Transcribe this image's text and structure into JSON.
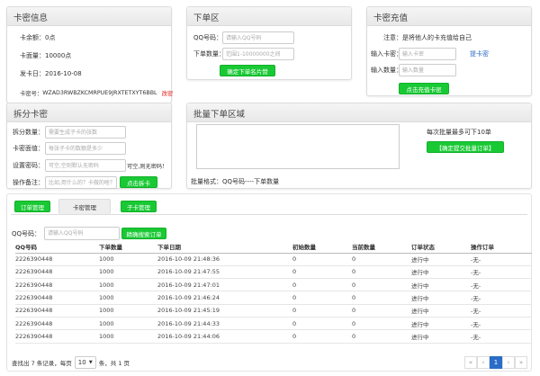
{
  "card_info": {
    "title": "卡密信息",
    "balance_label": "卡余额：",
    "balance_value": "0点",
    "quantity_label": "卡面量：",
    "quantity_value": "10000点",
    "issue_date_label": "发卡日：",
    "issue_date_value": "2016-10-08",
    "card_no_label": "卡密号：",
    "card_no_value": "WZAD3RWBZKCMRPUE9JRXTETXYT6BBL",
    "change_link": "改密"
  },
  "order_area": {
    "title": "下单区",
    "qq_label": "QQ号码：",
    "qq_placeholder": "请输入QQ号码",
    "qty_label": "下单数量：",
    "qty_placeholder": "范围1-10000000之间",
    "submit": "确定下单名片赞"
  },
  "recharge": {
    "title": "卡密充值",
    "notice_label": "注意：",
    "notice_text": "是将他人的卡充值给自己",
    "card_label": "输入卡密：",
    "card_placeholder": "输入卡密",
    "buy_link": "提卡密",
    "qty_label": "输入数量：",
    "qty_placeholder": "输入数量",
    "submit": "点击充值卡密"
  },
  "split": {
    "title": "拆分卡密",
    "count_label": "拆分数量：",
    "count_placeholder": "需要生成子卡的张数",
    "face_label": "卡密面值：",
    "face_placeholder": "每张子卡的数额是多少",
    "pwd_label": "设置密码：",
    "pwd_placeholder": "可空,空则默认无密码",
    "pwd_note": "可空,则无密码！",
    "remark_label": "操作备注：",
    "remark_placeholder": "比如,用什么的？卡做的啥？",
    "submit": "点击拆卡"
  },
  "batch": {
    "title": "批量下单区域",
    "limit_text": "每次批量最多可下10单",
    "submit": "【确定提交批量订单】",
    "format_text": "批量格式：QQ号码----下单数量"
  },
  "tabs": [
    {
      "label": "订单管理"
    },
    {
      "label": "卡密管理"
    },
    {
      "label": "子卡管理"
    }
  ],
  "search": {
    "qq_label": "QQ号码：",
    "placeholder": "请输入QQ号码",
    "submit": "精确搜索订单"
  },
  "table": {
    "headers": [
      "QQ号码",
      "下单数量",
      "下单日期",
      "初始数量",
      "当前数量",
      "订单状态",
      "操作订单"
    ],
    "rows": [
      [
        "2226390448",
        "1000",
        "2016-10-09 21:48:36",
        "0",
        "0",
        "进行中",
        "-无-"
      ],
      [
        "2226390448",
        "1000",
        "2016-10-09 21:47:55",
        "0",
        "0",
        "进行中",
        "-无-"
      ],
      [
        "2226390448",
        "1000",
        "2016-10-09 21:47:01",
        "0",
        "0",
        "进行中",
        "-无-"
      ],
      [
        "2226390448",
        "1000",
        "2016-10-09 21:46:24",
        "0",
        "0",
        "进行中",
        "-无-"
      ],
      [
        "2226390448",
        "1000",
        "2016-10-09 21:45:19",
        "0",
        "0",
        "进行中",
        "-无-"
      ],
      [
        "2226390448",
        "1000",
        "2016-10-09 21:44:33",
        "0",
        "0",
        "进行中",
        "-无-"
      ],
      [
        "2226390448",
        "1000",
        "2016-10-09 21:44:06",
        "0",
        "0",
        "进行中",
        "-无-"
      ]
    ]
  },
  "pagination": {
    "summary_prefix": "查找出 7 条记录，每页",
    "page_size": "10",
    "summary_suffix": "条，共 1 页",
    "first": "«",
    "prev": "‹",
    "current": "1",
    "next": "›",
    "last": "»"
  },
  "colors": {
    "accent_green": "#19c934",
    "link_red": "#e02020",
    "link_blue": "#2a6dc8"
  }
}
